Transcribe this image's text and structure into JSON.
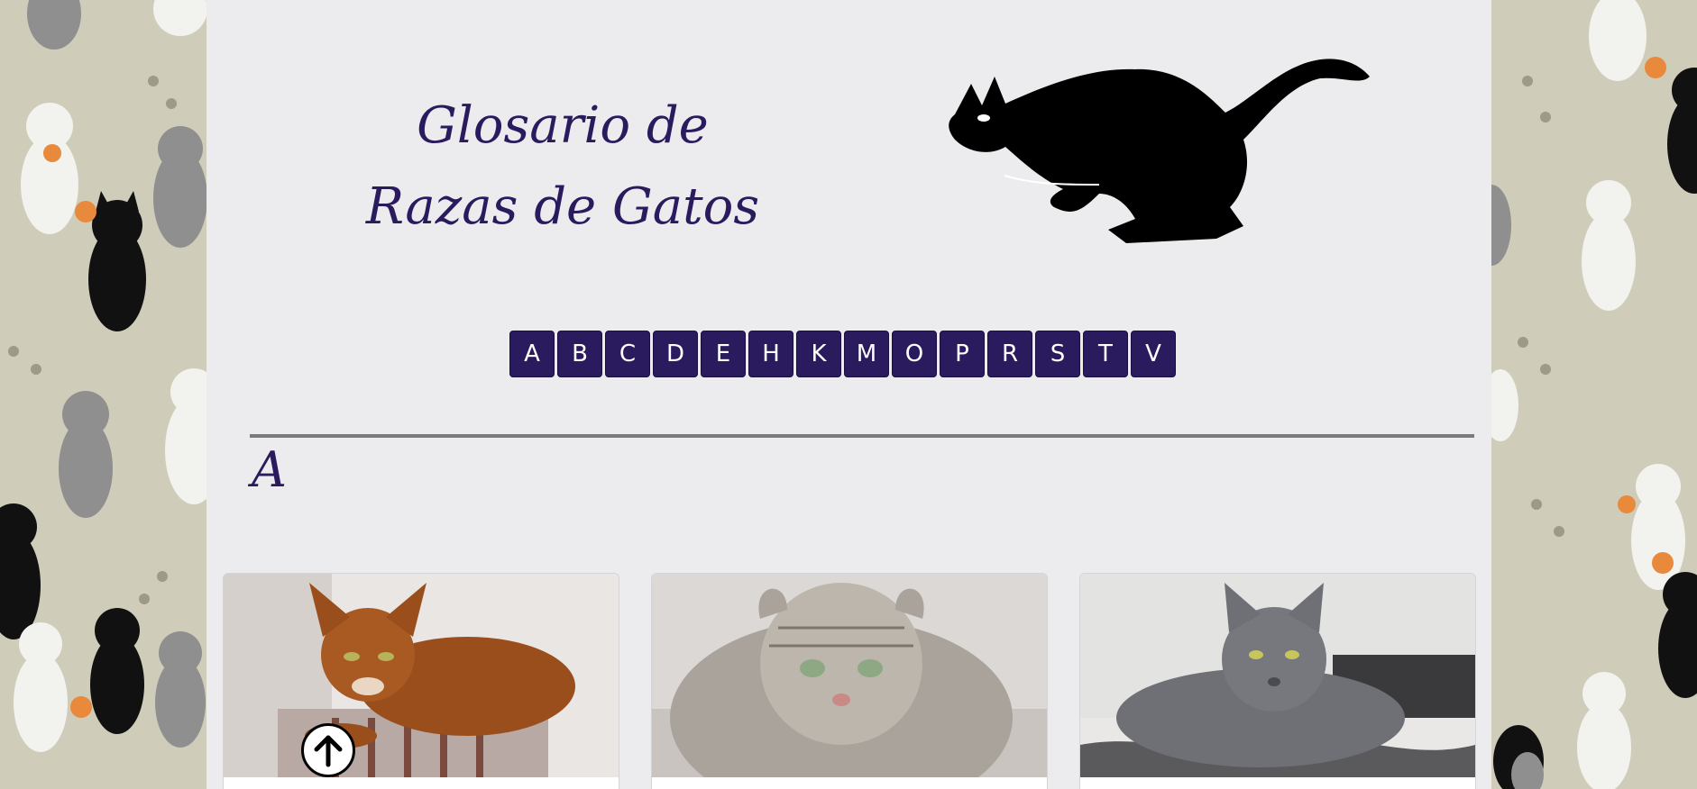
{
  "header": {
    "title_line1": "Glosario de",
    "title_line2": "Razas de Gatos"
  },
  "alphabet_nav": [
    "A",
    "B",
    "C",
    "D",
    "E",
    "H",
    "K",
    "M",
    "O",
    "P",
    "R",
    "S",
    "T",
    "V"
  ],
  "section": {
    "letter": "A"
  },
  "cards": [
    {
      "image": "abyssinian-cat-photo"
    },
    {
      "image": "american-curl-cat-photo"
    },
    {
      "image": "russian-blue-cat-photo"
    }
  ],
  "back_to_top": {
    "icon": "arrow-up-icon"
  },
  "colors": {
    "accent": "#2a1a5e",
    "page_background": "#ececee",
    "wallpaper": "#cfcdb9"
  }
}
